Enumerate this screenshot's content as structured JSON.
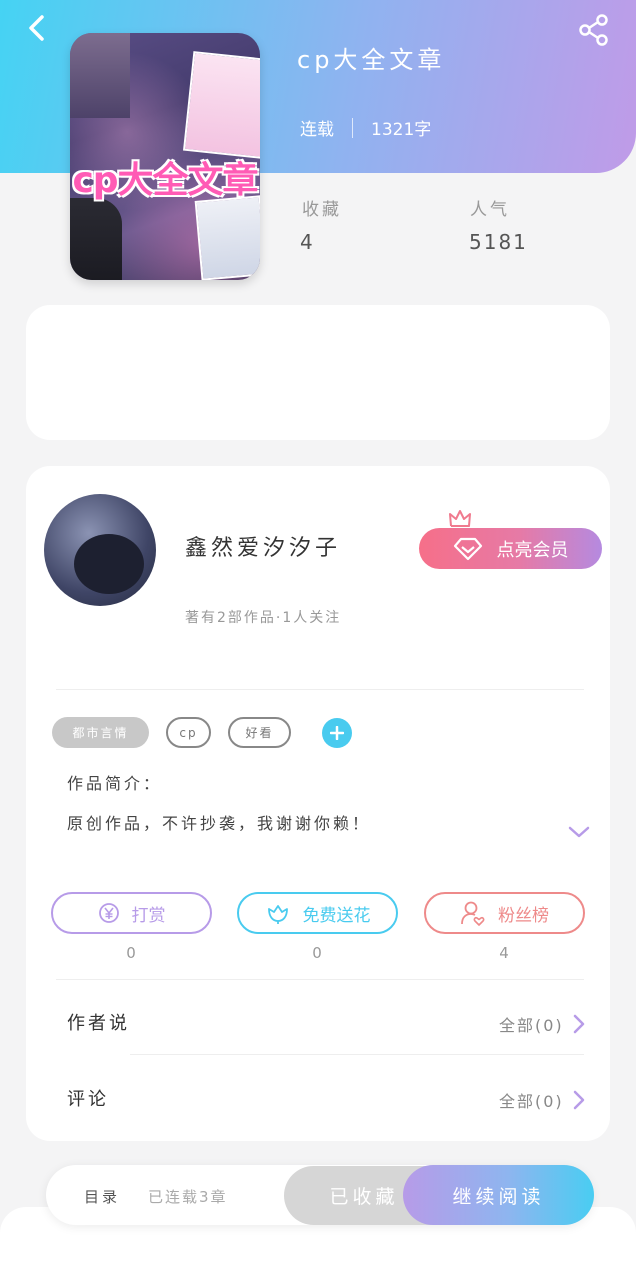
{
  "header": {
    "back_icon": "chevron-left-icon",
    "share_icon": "share-icon",
    "gradient": [
      "#45d3f3",
      "#c09be8"
    ]
  },
  "book": {
    "cover_title": "cp大全文章",
    "title": "cp大全文章",
    "status": "连载",
    "word_count": "1321字",
    "stats": [
      {
        "label": "收藏",
        "value": "4"
      },
      {
        "label": "人气",
        "value": "5181"
      }
    ]
  },
  "author": {
    "name": "鑫然爱汐汐子",
    "summary": "著有2部作品·1人关注",
    "vip_button": "点亮会员"
  },
  "tags": [
    {
      "label": "都市言情",
      "style": "filled"
    },
    {
      "label": "cp",
      "style": "outline"
    },
    {
      "label": "好看",
      "style": "outline"
    }
  ],
  "intro": {
    "label": "作品简介：",
    "text": "原创作品，不许抄袭，我谢谢你赖！"
  },
  "actions": [
    {
      "label": "打赏",
      "icon": "yen-coin-icon",
      "count": "0",
      "color": "#b79be8"
    },
    {
      "label": "免费送花",
      "icon": "flower-icon",
      "count": "0",
      "color": "#49cbef"
    },
    {
      "label": "粉丝榜",
      "icon": "fan-user-icon",
      "count": "4",
      "color": "#ee8a8a"
    }
  ],
  "rows": [
    {
      "label": "作者说",
      "link": "全部(0)"
    },
    {
      "label": "评论",
      "link": "全部(0)"
    }
  ],
  "bottom_bar": {
    "toc": "目录",
    "chapters": "已连载3章",
    "collected": "已收藏",
    "read": "继续阅读"
  }
}
